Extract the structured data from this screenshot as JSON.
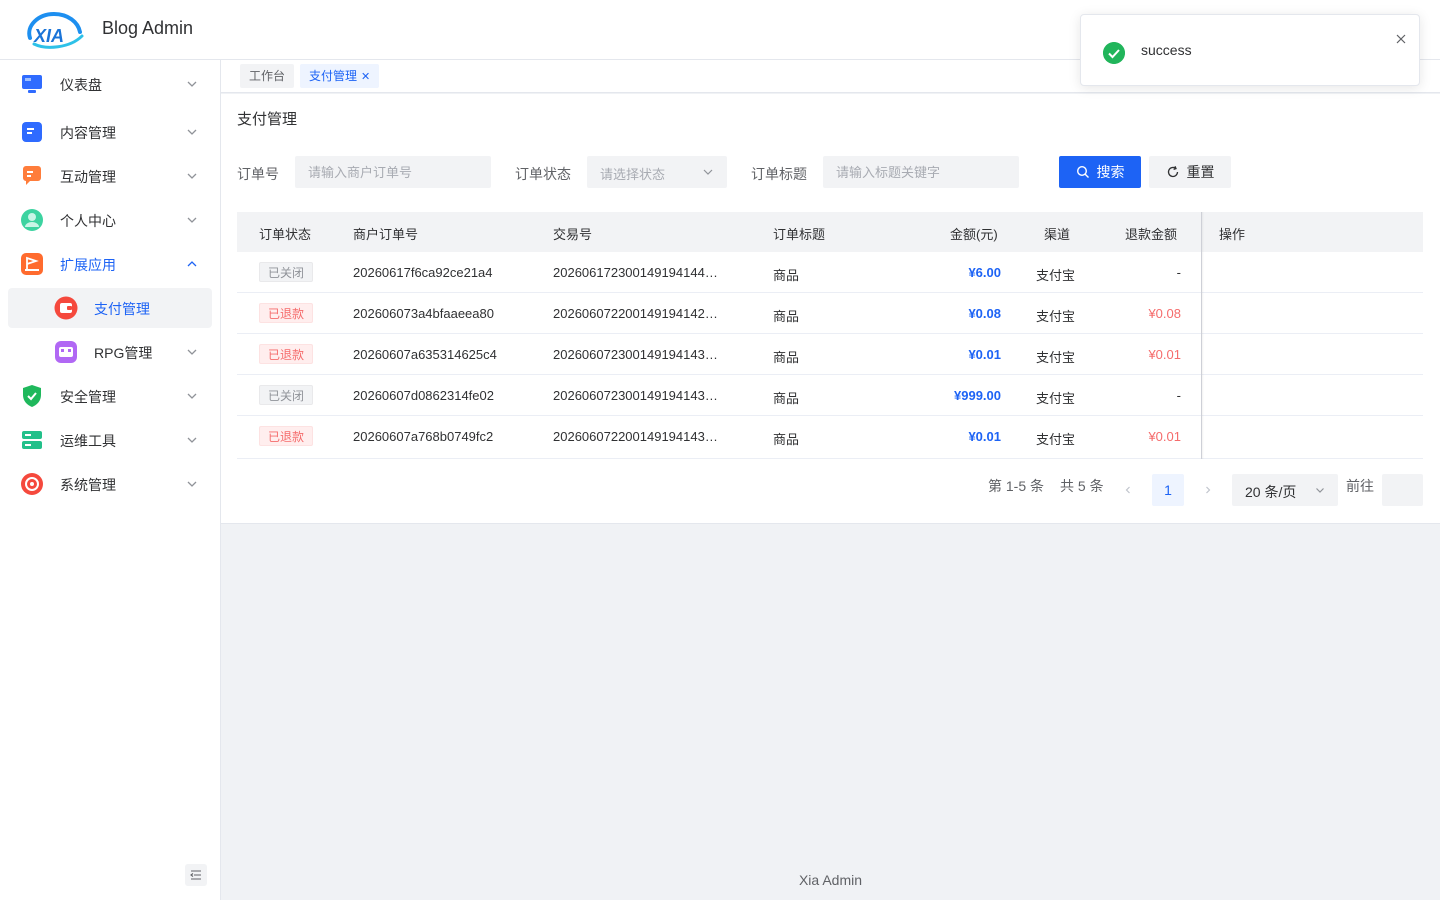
{
  "header": {
    "brand": "Blog Admin",
    "logo_text": "XIA"
  },
  "toast": {
    "message": "success",
    "icon": "check-circle-icon"
  },
  "sidebar": {
    "items": [
      {
        "label": "仪表盘",
        "icon": "monitor-icon",
        "color": "#2f6bff"
      },
      {
        "label": "内容管理",
        "icon": "document-icon",
        "color": "#2f6bff"
      },
      {
        "label": "互动管理",
        "icon": "chat-icon",
        "color": "#ff7d3b"
      },
      {
        "label": "个人中心",
        "icon": "user-icon",
        "color": "#3cd3a0"
      },
      {
        "label": "扩展应用",
        "icon": "flag-icon",
        "color": "#ff6b2e"
      },
      {
        "label": "支付管理",
        "icon": "wallet-icon",
        "color": "#f5493d"
      },
      {
        "label": "RPG管理",
        "icon": "game-icon",
        "color": "#b168f4"
      },
      {
        "label": "安全管理",
        "icon": "shield-icon",
        "color": "#1fb85c"
      },
      {
        "label": "运维工具",
        "icon": "server-icon",
        "color": "#22c08a"
      },
      {
        "label": "系统管理",
        "icon": "settings-icon",
        "color": "#f5493d"
      }
    ]
  },
  "tags": {
    "workbench": "工作台",
    "payment": "支付管理"
  },
  "page": {
    "title": "支付管理"
  },
  "filters": {
    "order_no_label": "订单号",
    "order_no_placeholder": "请输入商户订单号",
    "status_label": "订单状态",
    "status_placeholder": "请选择状态",
    "title_label": "订单标题",
    "title_placeholder": "请输入标题关键字",
    "search_label": "搜索",
    "reset_label": "重置"
  },
  "table": {
    "headers": {
      "status": "订单状态",
      "merchant_no": "商户订单号",
      "trade_no": "交易号",
      "title": "订单标题",
      "amount": "金额(元)",
      "channel": "渠道",
      "refund": "退款金额",
      "actions": "操作"
    },
    "rows": [
      {
        "status": "已关闭",
        "status_type": "closed",
        "merchant_no": "20260617f6ca92ce21a4",
        "trade_no": "202606172300149194144…",
        "title": "商品",
        "amount": "¥6.00",
        "channel": "支付宝",
        "refund": "-"
      },
      {
        "status": "已退款",
        "status_type": "refund",
        "merchant_no": "202606073a4bfaaeea80",
        "trade_no": "202606072200149194142…",
        "title": "商品",
        "amount": "¥0.08",
        "channel": "支付宝",
        "refund": "¥0.08"
      },
      {
        "status": "已退款",
        "status_type": "refund",
        "merchant_no": "20260607a635314625c4",
        "trade_no": "202606072300149194143…",
        "title": "商品",
        "amount": "¥0.01",
        "channel": "支付宝",
        "refund": "¥0.01"
      },
      {
        "status": "已关闭",
        "status_type": "closed",
        "merchant_no": "20260607d0862314fe02",
        "trade_no": "202606072300149194143…",
        "title": "商品",
        "amount": "¥999.00",
        "channel": "支付宝",
        "refund": "-"
      },
      {
        "status": "已退款",
        "status_type": "refund",
        "merchant_no": "20260607a768b0749fc2",
        "trade_no": "202606072200149194143…",
        "title": "商品",
        "amount": "¥0.01",
        "channel": "支付宝",
        "refund": "¥0.01"
      }
    ]
  },
  "pagination": {
    "range": "第 1-5 条",
    "total": "共 5 条",
    "current_page": "1",
    "page_size": "20 条/页",
    "goto_label": "前往"
  },
  "footer": {
    "text": "Xia Admin"
  }
}
